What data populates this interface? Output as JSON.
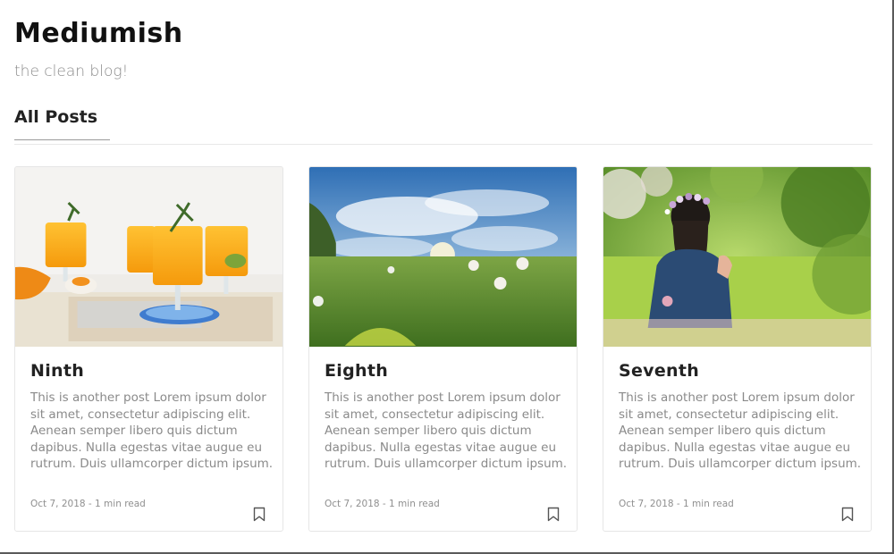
{
  "site": {
    "title": "Mediumish",
    "tagline": "the clean blog!"
  },
  "section": {
    "title": "All Posts"
  },
  "posts": [
    {
      "title": "Ninth",
      "excerpt": "This is another post Lorem ipsum dolor sit amet, consectetur adipiscing elit. Aenean semper libero quis dictum dapibus. Nulla egestas vitae augue eu rutrum. Duis ullamcorper dictum ipsum.",
      "meta": "Oct 7, 2018 - 1 min read",
      "image": "orange-juice-glasses",
      "bookmark_icon": "bookmark-icon"
    },
    {
      "title": "Eighth",
      "excerpt": "This is another post Lorem ipsum dolor sit amet, consectetur adipiscing elit. Aenean semper libero quis dictum dapibus. Nulla egestas vitae augue eu rutrum. Duis ullamcorper dictum ipsum.",
      "meta": "Oct 7, 2018 - 1 min read",
      "image": "sky-meadow-dandelions",
      "bookmark_icon": "bookmark-icon"
    },
    {
      "title": "Seventh",
      "excerpt": "This is another post Lorem ipsum dolor sit amet, consectetur adipiscing elit. Aenean semper libero quis dictum dapibus. Nulla egestas vitae augue eu rutrum. Duis ullamcorper dictum ipsum.",
      "meta": "Oct 7, 2018 - 1 min read",
      "image": "girl-flower-crown-garden",
      "bookmark_icon": "bookmark-icon"
    }
  ],
  "colors": {
    "text_dark": "#222222",
    "text_muted": "#8a8a8a",
    "card_border": "#e6e6e6"
  }
}
